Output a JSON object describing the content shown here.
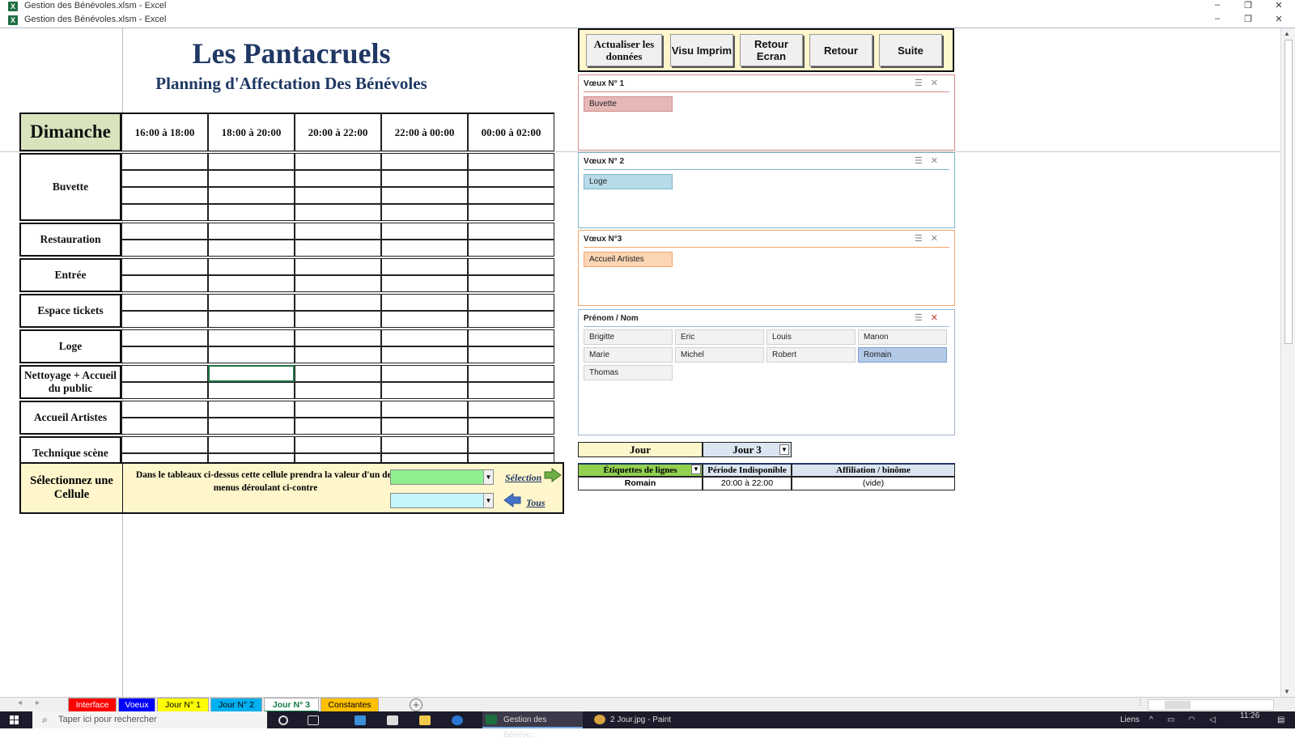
{
  "window": {
    "title_1": "Gestion des Bénévoles.xlsm - Excel",
    "title_2": "Gestion des Bénévoles.xlsm - Excel",
    "min": "–",
    "restore": "❐",
    "close": "✕"
  },
  "header": {
    "title": "Les Pantacruels",
    "subtitle": "Planning d'Affectation Des Bénévoles"
  },
  "grid": {
    "day": "Dimanche",
    "time_slots": [
      "16:00 à 18:00",
      "18:00 à 20:00",
      "20:00 à 22:00",
      "22:00 à 00:00",
      "00:00 à 02:00"
    ],
    "rows": [
      {
        "label": "Buvette",
        "lines": 4
      },
      {
        "label": "Restauration",
        "lines": 2
      },
      {
        "label": "Entrée",
        "lines": 2
      },
      {
        "label": "Espace tickets",
        "lines": 2
      },
      {
        "label": "Loge",
        "lines": 2
      },
      {
        "label": "Nettoyage + Accueil du public",
        "lines": 2
      },
      {
        "label": "Accueil Artistes",
        "lines": 2
      },
      {
        "label": "Technique scène",
        "lines": 2
      }
    ]
  },
  "selection_box": {
    "label": "Sélectionnez une Cellule",
    "description": "Dans le tableaux ci-dessus cette cellule prendra la valeur d'un des menus déroulant  ci-contre",
    "link_selection": "Sélection",
    "link_all": "Tous",
    "dropdown_1_color": "#90f090",
    "dropdown_2_color": "#c4f6fb"
  },
  "buttons": {
    "refresh": "Actualiser les données",
    "print_preview": "Visu Imprim",
    "back_screen": "Retour Ecran",
    "back": "Retour",
    "next": "Suite"
  },
  "slicers": [
    {
      "title": "Vœux N° 1",
      "items": [
        "Buvette"
      ],
      "color": "#e6b8b7",
      "rule": "#d08c8a"
    },
    {
      "title": "Vœux N° 2",
      "items": [
        "Loge"
      ],
      "color": "#b7dbe8",
      "rule": "#7fb7cc"
    },
    {
      "title": "Vœux N°3",
      "items": [
        "Accueil Artistes"
      ],
      "color": "#fcd5b4",
      "rule": "#f1a46b"
    }
  ],
  "names_slicer": {
    "title": "Prénom / Nom",
    "items": [
      "Brigitte",
      "Eric",
      "Louis",
      "Manon",
      "Marie",
      "Michel",
      "Robert",
      "Romain",
      "Thomas"
    ],
    "selected": "Romain"
  },
  "pivot": {
    "day_label": "Jour",
    "day_value": "Jour 3",
    "headers": [
      "Étiquettes de lignes",
      "Période Indisponible",
      "Affiliation / binôme"
    ],
    "row": [
      "Romain",
      "20:00 à 22:00",
      "(vide)"
    ]
  },
  "tabs": [
    {
      "label": "Interface",
      "bg": "#ff0000",
      "fg": "#ffffff"
    },
    {
      "label": "Voeux",
      "bg": "#0000ff",
      "fg": "#ffffff"
    },
    {
      "label": "Jour N° 1",
      "bg": "#ffff00",
      "fg": "#000000"
    },
    {
      "label": "Jour N° 2",
      "bg": "#00b0f0",
      "fg": "#000000"
    },
    {
      "label": "Jour N° 3",
      "bg": "#ffffff",
      "fg": "#107c41"
    },
    {
      "label": "Constantes",
      "bg": "#ffc000",
      "fg": "#000000"
    }
  ],
  "taskbar": {
    "search_placeholder": "Taper ici pour rechercher",
    "excel_item": "Gestion des Bénévo...",
    "paint_item": "2 Jour.jpg - Paint",
    "tray_text": "Liens",
    "clock": "11:26"
  }
}
